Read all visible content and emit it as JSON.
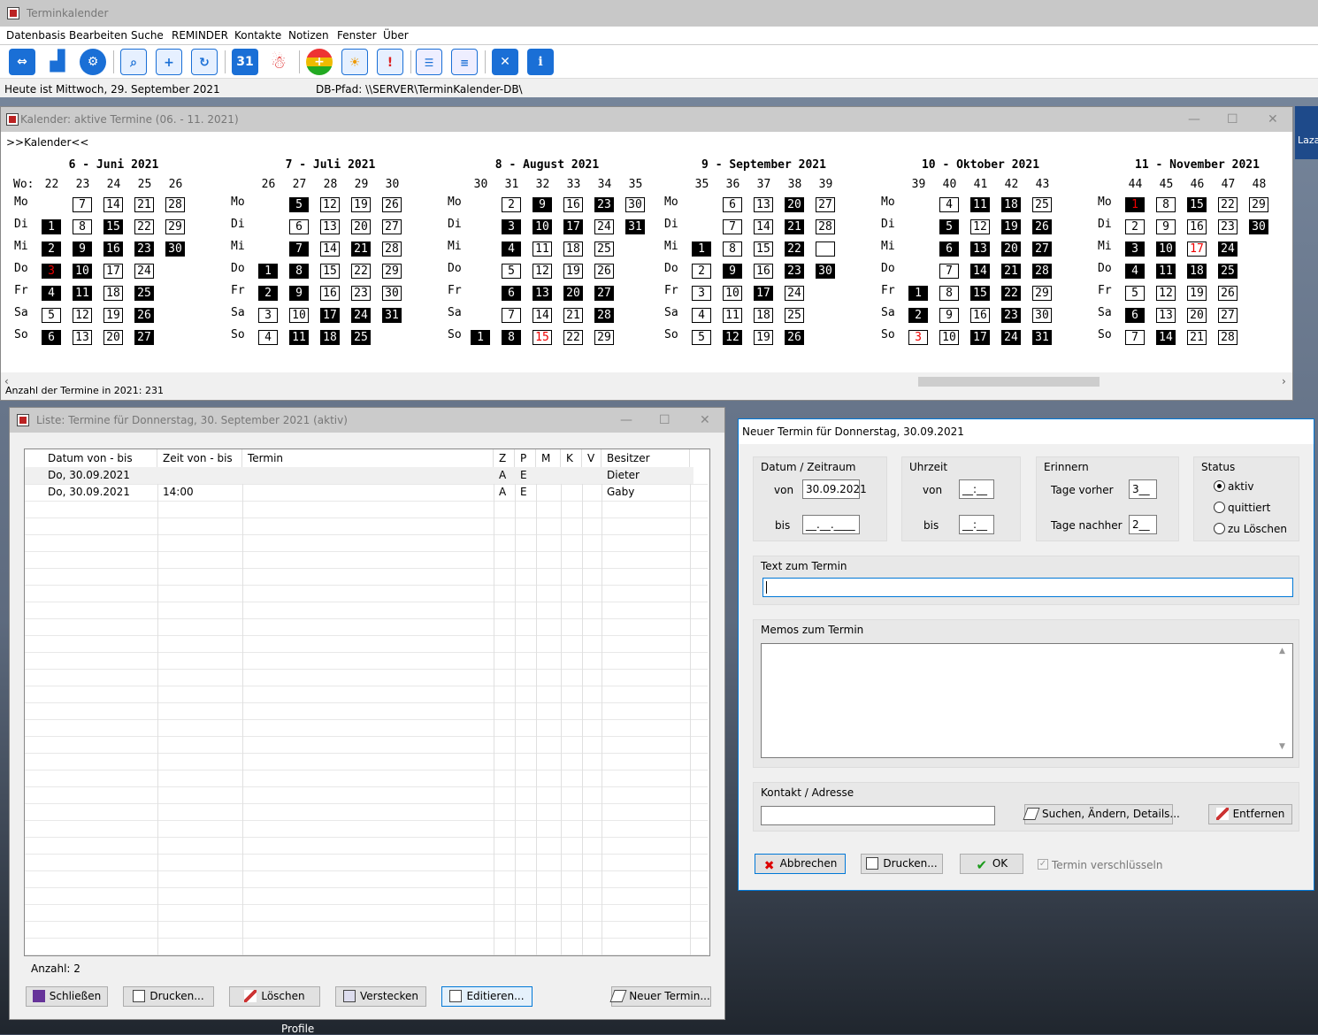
{
  "app": {
    "title": "Terminkalender",
    "menu": [
      "Datenbasis",
      "Bearbeiten",
      "Suche",
      "REMINDER",
      "Kontakte",
      "Notizen",
      "Fenster",
      "Über"
    ],
    "toolbar_icons": [
      "swap-icon",
      "bar-chart-icon",
      "gear-icon",
      "search-calendar-icon",
      "add-calendar-icon",
      "refresh-calendar-icon",
      "calendar-31-icon",
      "santa-icon",
      "traffic-light-icon",
      "calendar-sun-icon",
      "calendar-alert-icon",
      "form-icon",
      "notes-icon",
      "close-icon",
      "info-icon"
    ],
    "status_left": "Heute ist Mittwoch, 29. September 2021",
    "status_right": "DB-Pfad: \\\\SERVER\\TerminKalender-DB\\",
    "toolbar_31": "31",
    "toolbar_x": "✕",
    "toolbar_i": "i"
  },
  "calendar_window": {
    "title": "Kalender: aktive Termine  (06. - 11. 2021)",
    "subtitle": ">>Kalender<<",
    "wo_label": "Wo:",
    "footer": "Anzahl der Termine in 2021: 231",
    "months": [
      {
        "title": "6 - Juni 2021",
        "weeks": [
          "22",
          "23",
          "24",
          "25",
          "26"
        ],
        "day_labels": [
          "Mo",
          "Di",
          "Mi",
          "Do",
          "Fr",
          "Sa",
          "So"
        ],
        "days": [
          [
            "",
            "7",
            "14",
            "21",
            "28"
          ],
          [
            "1",
            "8",
            "15",
            "22",
            "29"
          ],
          [
            "2",
            "9",
            "16",
            "23",
            "30"
          ],
          [
            "3",
            "10",
            "17",
            "24",
            ""
          ],
          [
            "4",
            "11",
            "18",
            "25",
            ""
          ],
          [
            "5",
            "12",
            "19",
            "26",
            ""
          ],
          [
            "6",
            "13",
            "20",
            "27",
            ""
          ]
        ],
        "filled": [
          "1",
          "2",
          "3",
          "4",
          "6",
          "9",
          "10",
          "11",
          "15",
          "16",
          "23",
          "25",
          "26",
          "27",
          "30"
        ],
        "red": [
          "3"
        ]
      },
      {
        "title": "7 - Juli 2021",
        "weeks": [
          "26",
          "27",
          "28",
          "29",
          "30"
        ],
        "day_labels": [
          "Mo",
          "Di",
          "Mi",
          "Do",
          "Fr",
          "Sa",
          "So"
        ],
        "days": [
          [
            "",
            "5",
            "12",
            "19",
            "26"
          ],
          [
            "",
            "6",
            "13",
            "20",
            "27"
          ],
          [
            "",
            "7",
            "14",
            "21",
            "28"
          ],
          [
            "1",
            "8",
            "15",
            "22",
            "29"
          ],
          [
            "2",
            "9",
            "16",
            "23",
            "30"
          ],
          [
            "3",
            "10",
            "17",
            "24",
            "31"
          ],
          [
            "4",
            "11",
            "18",
            "25",
            ""
          ]
        ],
        "filled": [
          "1",
          "2",
          "5",
          "7",
          "8",
          "9",
          "11",
          "17",
          "18",
          "21",
          "24",
          "25",
          "31"
        ],
        "red": []
      },
      {
        "title": "8 - August 2021",
        "weeks": [
          "30",
          "31",
          "32",
          "33",
          "34",
          "35"
        ],
        "day_labels": [
          "Mo",
          "Di",
          "Mi",
          "Do",
          "Fr",
          "Sa",
          "So"
        ],
        "days": [
          [
            "",
            "2",
            "9",
            "16",
            "23",
            "30"
          ],
          [
            "",
            "3",
            "10",
            "17",
            "24",
            "31"
          ],
          [
            "",
            "4",
            "11",
            "18",
            "25",
            ""
          ],
          [
            "",
            "5",
            "12",
            "19",
            "26",
            ""
          ],
          [
            "",
            "6",
            "13",
            "20",
            "27",
            ""
          ],
          [
            "",
            "7",
            "14",
            "21",
            "28",
            ""
          ],
          [
            "1",
            "8",
            "15",
            "22",
            "29",
            ""
          ]
        ],
        "filled": [
          "1",
          "3",
          "4",
          "6",
          "8",
          "9",
          "10",
          "13",
          "17",
          "20",
          "23",
          "27",
          "28",
          "31"
        ],
        "red": [
          "15"
        ]
      },
      {
        "title": "9 - September 2021",
        "weeks": [
          "35",
          "36",
          "37",
          "38",
          "39"
        ],
        "day_labels": [
          "Mo",
          "Di",
          "Mi",
          "Do",
          "Fr",
          "Sa",
          "So"
        ],
        "days": [
          [
            "",
            "6",
            "13",
            "20",
            "27"
          ],
          [
            "",
            "7",
            "14",
            "21",
            "28"
          ],
          [
            "1",
            "8",
            "15",
            "22",
            ""
          ],
          [
            "2",
            "9",
            "16",
            "23",
            "30"
          ],
          [
            "3",
            "10",
            "17",
            "24",
            ""
          ],
          [
            "4",
            "11",
            "18",
            "25",
            ""
          ],
          [
            "5",
            "12",
            "19",
            "26",
            ""
          ]
        ],
        "filled": [
          "1",
          "9",
          "12",
          "17",
          "20",
          "21",
          "22",
          "23",
          "26",
          "30"
        ],
        "red": [],
        "empty_box_29": true
      },
      {
        "title": "10 - Oktober 2021",
        "weeks": [
          "39",
          "40",
          "41",
          "42",
          "43"
        ],
        "day_labels": [
          "Mo",
          "Di",
          "Mi",
          "Do",
          "Fr",
          "Sa",
          "So"
        ],
        "days": [
          [
            "",
            "4",
            "11",
            "18",
            "25"
          ],
          [
            "",
            "5",
            "12",
            "19",
            "26"
          ],
          [
            "",
            "6",
            "13",
            "20",
            "27"
          ],
          [
            "",
            "7",
            "14",
            "21",
            "28"
          ],
          [
            "1",
            "8",
            "15",
            "22",
            "29"
          ],
          [
            "2",
            "9",
            "16",
            "23",
            "30"
          ],
          [
            "3",
            "10",
            "17",
            "24",
            "31"
          ]
        ],
        "filled": [
          "1",
          "2",
          "5",
          "6",
          "11",
          "13",
          "14",
          "15",
          "17",
          "18",
          "19",
          "20",
          "21",
          "22",
          "23",
          "24",
          "26",
          "27",
          "28",
          "31"
        ],
        "red": [
          "3"
        ]
      },
      {
        "title": "11 - November 2021",
        "weeks": [
          "44",
          "45",
          "46",
          "47",
          "48"
        ],
        "day_labels": [
          "Mo",
          "Di",
          "Mi",
          "Do",
          "Fr",
          "Sa",
          "So"
        ],
        "days": [
          [
            "1",
            "8",
            "15",
            "22",
            "29"
          ],
          [
            "2",
            "9",
            "16",
            "23",
            "30"
          ],
          [
            "3",
            "10",
            "17",
            "24",
            ""
          ],
          [
            "4",
            "11",
            "18",
            "25",
            ""
          ],
          [
            "5",
            "12",
            "19",
            "26",
            ""
          ],
          [
            "6",
            "13",
            "20",
            "27",
            ""
          ],
          [
            "7",
            "14",
            "21",
            "28",
            ""
          ]
        ],
        "filled": [
          "1",
          "3",
          "4",
          "6",
          "10",
          "11",
          "14",
          "15",
          "18",
          "24",
          "25",
          "30"
        ],
        "red": [
          "1",
          "17"
        ]
      }
    ]
  },
  "list_window": {
    "title": "Liste: Termine für Donnerstag, 30. September 2021  (aktiv)",
    "columns": [
      "Datum von - bis",
      "Zeit von - bis",
      "Termin",
      "Z",
      "P",
      "M",
      "K",
      "V",
      "Besitzer"
    ],
    "rows": [
      {
        "datum": "Do, 30.09.2021",
        "zeit": "",
        "termin": "",
        "z": "A",
        "p": "E",
        "m": "",
        "k": "",
        "v": "",
        "besitzer": "Dieter"
      },
      {
        "datum": "Do, 30.09.2021",
        "zeit": "14:00",
        "termin": "",
        "z": "A",
        "p": "E",
        "m": "",
        "k": "",
        "v": "",
        "besitzer": "Gaby"
      }
    ],
    "count": "Anzahl: 2",
    "buttons": {
      "close": "Schließen",
      "print": "Drucken...",
      "delete": "Löschen",
      "hide": "Verstecken",
      "edit": "Editieren...",
      "new": "Neuer Termin..."
    }
  },
  "new_dialog": {
    "title": "Neuer Termin für Donnerstag, 30.09.2021",
    "date_group": {
      "title": "Datum / Zeitraum",
      "from_label": "von",
      "from_value": "30.09.2021",
      "to_label": "bis",
      "to_value": "__.__.____"
    },
    "time_group": {
      "title": "Uhrzeit",
      "from_label": "von",
      "from_value": "__:__",
      "to_label": "bis",
      "to_value": "__:__"
    },
    "remind_group": {
      "title": "Erinnern",
      "before_label": "Tage vorher",
      "before_value": "3__",
      "after_label": "Tage nachher",
      "after_value": "2__"
    },
    "status_group": {
      "title": "Status",
      "options": [
        "aktiv",
        "quittiert",
        "zu Löschen"
      ],
      "selected": "aktiv"
    },
    "text_label": "Text zum Termin",
    "text_value": "",
    "memo_label": "Memos zum Termin",
    "memo_value": "",
    "contact_label": "Kontakt / Adresse",
    "contact_value": "",
    "buttons": {
      "search": "Suchen, Ändern, Details...",
      "remove": "Entfernen",
      "cancel": "Abbrechen",
      "print": "Drucken...",
      "ok": "OK"
    },
    "encrypt_label": "Termin verschlüsseln"
  },
  "desktop": {
    "profile_label": "Profile",
    "side_label": "Laza"
  }
}
